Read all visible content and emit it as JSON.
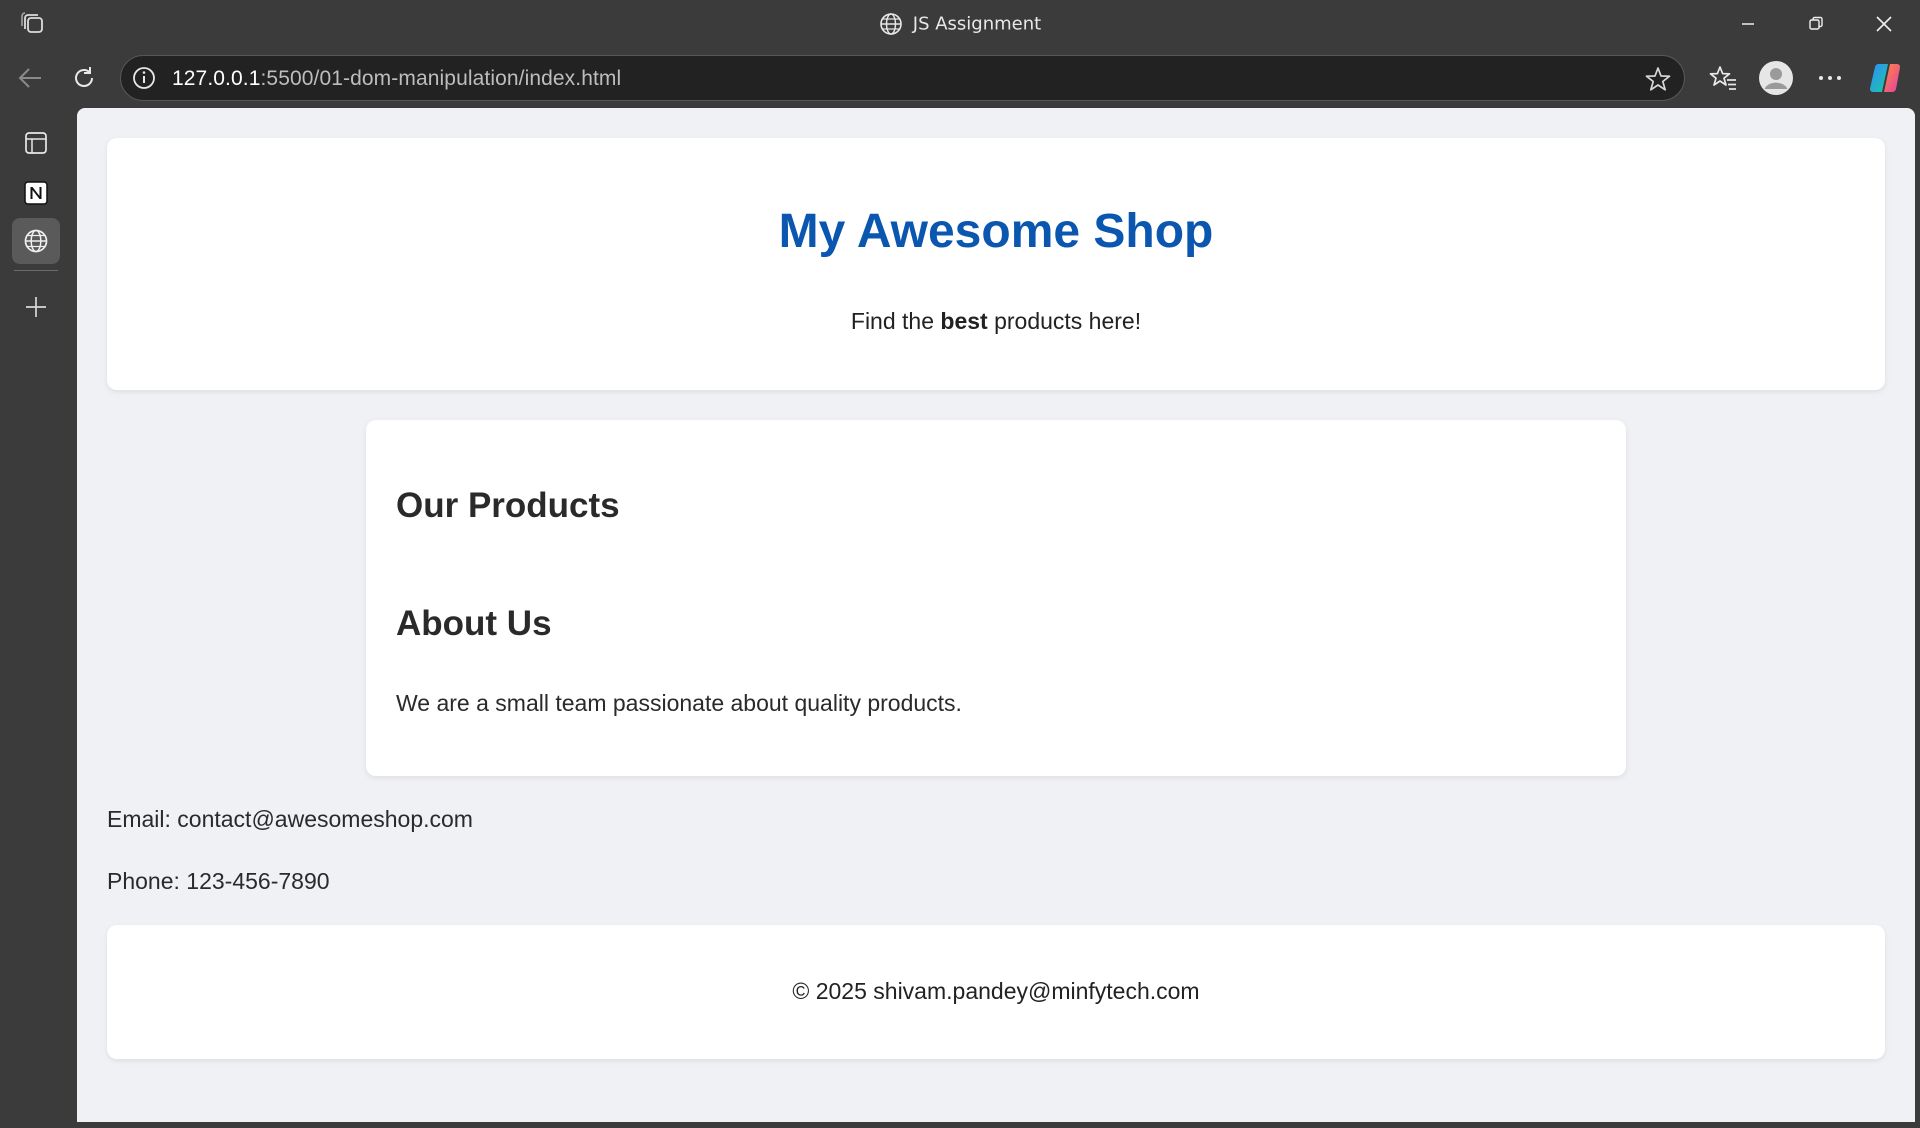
{
  "window": {
    "title": "JS Assignment"
  },
  "toolbar": {
    "url_host": "127.0.0.1",
    "url_rest": ":5500/01-dom-manipulation/index.html"
  },
  "icons": {
    "workspaces": "workspaces-icon",
    "tab_globe": "globe-icon",
    "minimize": "minimize-icon",
    "restore": "restore-icon",
    "close": "close-icon",
    "back": "back-arrow-icon",
    "refresh": "refresh-icon",
    "site_info": "info-icon",
    "favorite": "star-icon",
    "favorites": "favorites-icon",
    "profile": "avatar-icon",
    "more": "more-icon",
    "copilot": "copilot-icon",
    "sidebar": [
      "tab-actions-icon",
      "notion-icon",
      "globe-icon",
      "add-icon"
    ]
  },
  "page": {
    "header": {
      "title": "My Awesome Shop",
      "tagline_before": "Find the ",
      "tagline_bold": "best",
      "tagline_after": " products here!"
    },
    "main": {
      "products_heading": "Our Products",
      "about_heading": "About Us",
      "about_text": "We are a small team passionate about quality products."
    },
    "contact": {
      "email": "Email: contact@awesomeshop.com",
      "phone": "Phone: 123-456-7890"
    },
    "footer": {
      "copyright": "© 2025 shivam.pandey@minfytech.com"
    }
  },
  "colors": {
    "title_blue": "#0b57b0",
    "page_bg": "#f0f1f5",
    "chrome_bg": "#3b3b3b"
  }
}
